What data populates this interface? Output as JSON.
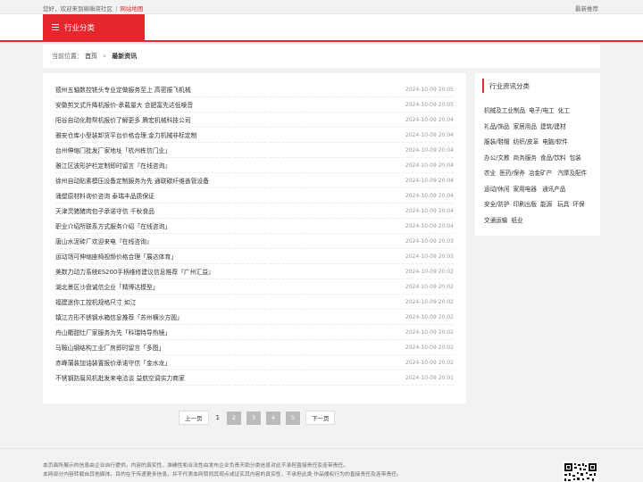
{
  "topbar": {
    "greeting": "您好，欢迎来到蝌蝌资社区",
    "sep": "|",
    "sitemap": "网站地图",
    "recommend": "最新推荐"
  },
  "nav": {
    "category_label": "行业分类"
  },
  "breadcrumb": {
    "prefix": "当前位置：",
    "home": "首页",
    "arrow": "»",
    "current": "最新资讯"
  },
  "news": [
    {
      "title": "德州五轴数控铣头专业定做服务至上 高密振飞机械",
      "date": "2024-10-09 20:05"
    },
    {
      "title": "安徽剪叉式升降机报价-承载量大 合肥富先达低噪音",
      "date": "2024-10-09 20:05"
    },
    {
      "title": "阳谷自动化鞋帮机报价了解更多 腾宏机械科技公司",
      "date": "2024-10-09 20:04"
    },
    {
      "title": "雅安仓库小型装卸货平台价格合理 金力机械非标定制",
      "date": "2024-10-09 20:04"
    },
    {
      "title": "台州伸缩门批发厂家地址「杭州栋信门业」",
      "date": "2024-10-09 20:04"
    },
    {
      "title": "雅江区波形护栏定制即时留言『在线咨询』",
      "date": "2024-10-09 20:04"
    },
    {
      "title": "徐州自动贴素模压设备定制服务为先 通联碳纤维善管设备",
      "date": "2024-10-09 20:04"
    },
    {
      "title": "涌塑原材料询价咨询 泰瑞丰品质保证",
      "date": "2024-10-09 20:04"
    },
    {
      "title": "天津灵猪猪肉包子承诺守信 千秋食品",
      "date": "2024-10-09 20:04"
    },
    {
      "title": "职业介绍所联系方式服务介绍「在线咨询」",
      "date": "2024-10-09 20:04"
    },
    {
      "title": "唐山水泥砖厂欢迎来电『在线咨询』",
      "date": "2024-10-09 20:03"
    },
    {
      "title": "运动场可伸缩座椅视频价格合理「展达体育」",
      "date": "2024-10-09 20:03"
    },
    {
      "title": "美数力动力系统ES200手柄维修建议信息推荐『广州汇益』",
      "date": "2024-10-09 20:02"
    },
    {
      "title": "湖北景区沙盘诚信企业「精博达模型」",
      "date": "2024-10-09 20:02"
    },
    {
      "title": "福建迷你工控机规格尺寸 如江",
      "date": "2024-10-09 20:02"
    },
    {
      "title": "镇江方形不锈钢水箱信息推荐「苏州横沙方圆」",
      "date": "2024-10-09 20:02"
    },
    {
      "title": "舟山衢甜灶厂家服务为先「科瑞特导热镜」",
      "date": "2024-10-09 20:02"
    },
    {
      "title": "马鞍山钢结构工业厂房即时留言「多图」",
      "date": "2024-10-09 20:02"
    },
    {
      "title": "赤峰蒲装加油装置报价承诺守信「金水龙」",
      "date": "2024-10-09 20:02"
    },
    {
      "title": "不锈钢防腐风机批发来电洽谈 益航空调实力商家",
      "date": "2024-10-09 20:01"
    }
  ],
  "pager": {
    "prev": "上一页",
    "current": "1",
    "pages": [
      "2",
      "3",
      "4",
      "5"
    ],
    "next": "下一页"
  },
  "sidebar": {
    "title": "行业资讯分类",
    "tags": [
      "机械及工业制品",
      "电子/电工",
      "化工",
      "礼品/饰品",
      "家居用品",
      "建筑/建材",
      "服装/鞋帽",
      "纺织/皮革",
      "电脑/软件",
      "办公/文教",
      "商务服务",
      "食品/饮料",
      "包装",
      "农业",
      "医药/保养",
      "冶金矿产",
      "汽摩及配件",
      "运动/休闲",
      "家用电器",
      "通讯产品",
      "安全/防护",
      "印刷出版",
      "能源",
      "玩具",
      "环保",
      "交通运输",
      "纸业"
    ]
  },
  "footer": {
    "line1": "本页面所展示的信息由企业自行提供，内容的真实性、准确性和合法性由发布企业负责天助分类信息对此不承担直接责任及连带责任。",
    "line2": "本网部分内容转载自其他媒体，目的在于传递更多信息，并不代表本网赞同其观点或证实其内容的真实性，不承担此类 作品侵权行为的直接责任及连带责任。"
  },
  "colors": {
    "accent": "#e6262d"
  },
  "icons": {
    "menu": "menu-icon",
    "qr": "qr-code-icon"
  }
}
